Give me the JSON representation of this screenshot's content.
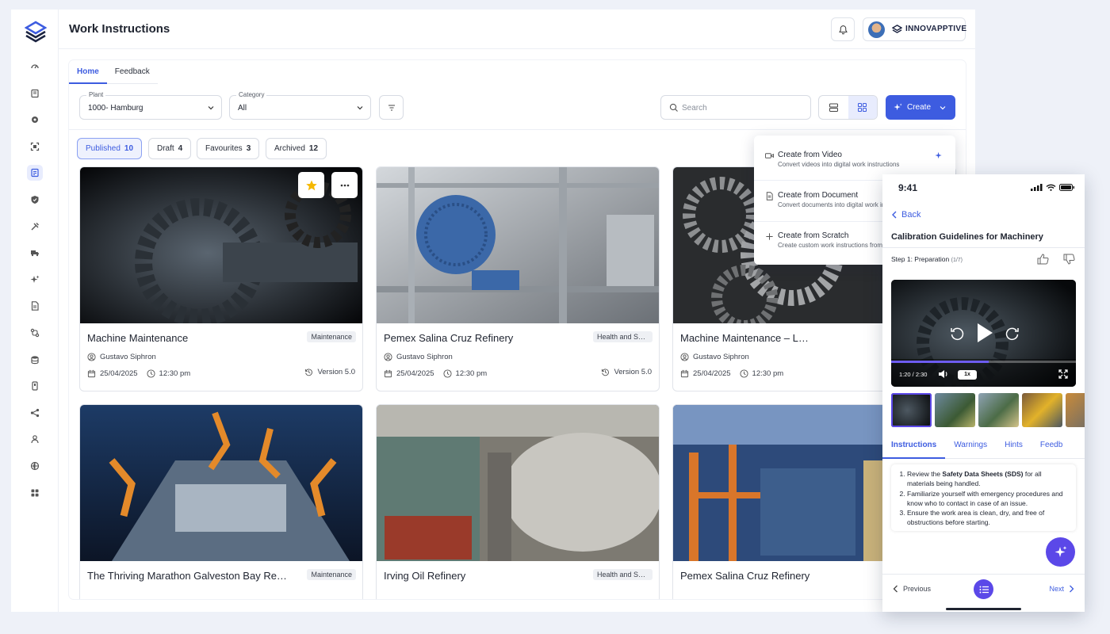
{
  "app": {
    "title": "Work Instructions",
    "brand": "INNOVAPPTIVE",
    "accent": "#3d5ce0",
    "secondary_accent": "#5b48e8"
  },
  "sidebar": {
    "icons": [
      "dashboard-icon",
      "inventory-icon",
      "asset-icon",
      "scanner-icon",
      "work-instructions-icon",
      "safety-icon",
      "tools-icon",
      "delivery-icon",
      "ai-sparkle-icon",
      "document-icon",
      "workflow-icon",
      "database-icon",
      "mobile-icon",
      "share-icon",
      "user-icon",
      "global-icon",
      "apps-icon"
    ]
  },
  "tabs": [
    {
      "label": "Home",
      "active": true
    },
    {
      "label": "Feedback",
      "active": false
    }
  ],
  "filters": {
    "plant": {
      "label": "Plant",
      "value": "1000- Hamburg"
    },
    "category": {
      "label": "Category",
      "value": "All"
    },
    "search_placeholder": "Search",
    "create_label": "Create"
  },
  "status_chips": [
    {
      "label": "Published",
      "count": "10",
      "active": true
    },
    {
      "label": "Draft",
      "count": "4",
      "active": false
    },
    {
      "label": "Favourites",
      "count": "3",
      "active": false
    },
    {
      "label": "Archived",
      "count": "12",
      "active": false
    }
  ],
  "create_menu": [
    {
      "title": "Create from Video",
      "subtitle": "Convert videos into digital work instructions",
      "icon": "video-icon"
    },
    {
      "title": "Create from Document",
      "subtitle": "Convert documents into digital work instructions",
      "icon": "document-icon"
    },
    {
      "title": "Create from Scratch",
      "subtitle": "Create custom work instructions from scratch",
      "icon": "plus-icon"
    }
  ],
  "cards": [
    {
      "title": "Machine Maintenance",
      "tag": "Maintenance",
      "author": "Gustavo Siphron",
      "date": "25/04/2025",
      "time": "12:30 pm",
      "version": "Version 5.0",
      "favourite": true
    },
    {
      "title": "Pemex Salina Cruz Refinery",
      "tag": "Health and Safety",
      "author": "Gustavo Siphron",
      "date": "25/04/2025",
      "time": "12:30 pm",
      "version": "Version 5.0",
      "favourite": false
    },
    {
      "title": "Machine Maintenance – L…",
      "tag": "",
      "author": "Gustavo Siphron",
      "date": "25/04/2025",
      "time": "12:30 pm",
      "version": "",
      "favourite": false
    },
    {
      "title": "The Thriving Marathon Galveston Bay Re…",
      "tag": "Maintenance"
    },
    {
      "title": "Irving Oil Refinery",
      "tag": "Health and Safety"
    },
    {
      "title": "Pemex Salina Cruz Refinery",
      "tag": ""
    }
  ],
  "phone": {
    "time": "9:41",
    "back": "Back",
    "title": "Calibration Guidelines for Machinery",
    "step": "Step 1: Preparation",
    "step_count": "(1/7)",
    "video_time": "1:20 / 2:30",
    "speed": "1x",
    "progress": 0.53,
    "tabs": [
      "Instructions",
      "Warnings",
      "Hints",
      "Feedb"
    ],
    "instructions": [
      {
        "pre": "Review the ",
        "bold": "Safety Data Sheets (SDS)",
        "post": " for all materials being handled."
      },
      {
        "pre": "Familiarize yourself with emergency procedures and know who to contact in case of an issue.",
        "bold": "",
        "post": ""
      },
      {
        "pre": "Ensure the work area is clean, dry, and free of obstructions before starting.",
        "bold": "",
        "post": ""
      }
    ],
    "previous": "Previous",
    "next": "Next"
  }
}
